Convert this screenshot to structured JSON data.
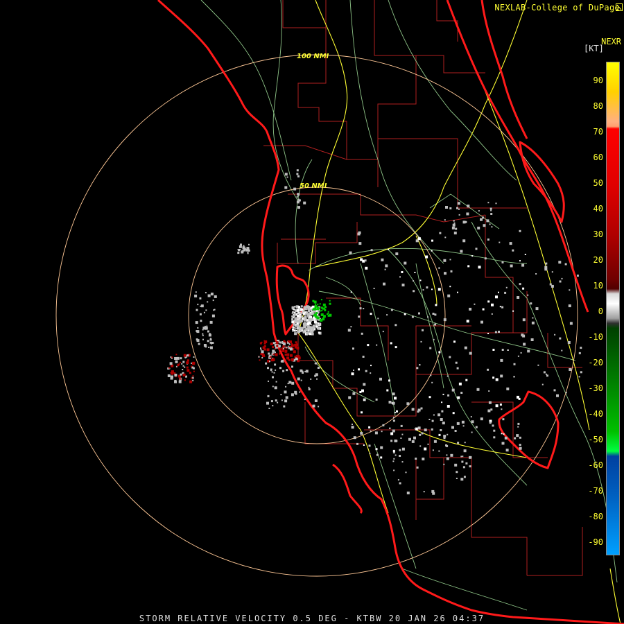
{
  "credit": "NEXLAB-College of DuPage",
  "footer": "STORM RELATIVE VELOCITY 0.5 DEG - KTBW 20 JAN 26 04:37",
  "legend": {
    "title": "NEXR",
    "unit": "[KT]",
    "ticks": [
      "90",
      "80",
      "70",
      "60",
      "50",
      "40",
      "30",
      "20",
      "10",
      "0",
      "-10",
      "-20",
      "-30",
      "-40",
      "-50",
      "-60",
      "-70",
      "-80",
      "-90"
    ]
  },
  "rings": {
    "outer_label": "100 NMI",
    "inner_label": "50 NMI"
  },
  "colors": {
    "coastline": "#ff1a1a",
    "county": "#b02020",
    "road_primary": "#ffff33",
    "road_secondary": "#a8e8a0",
    "ring": "#ffc896",
    "inbound_green": "#00c800",
    "outbound_red": "#b00000",
    "near_zero": "#bebebe"
  }
}
